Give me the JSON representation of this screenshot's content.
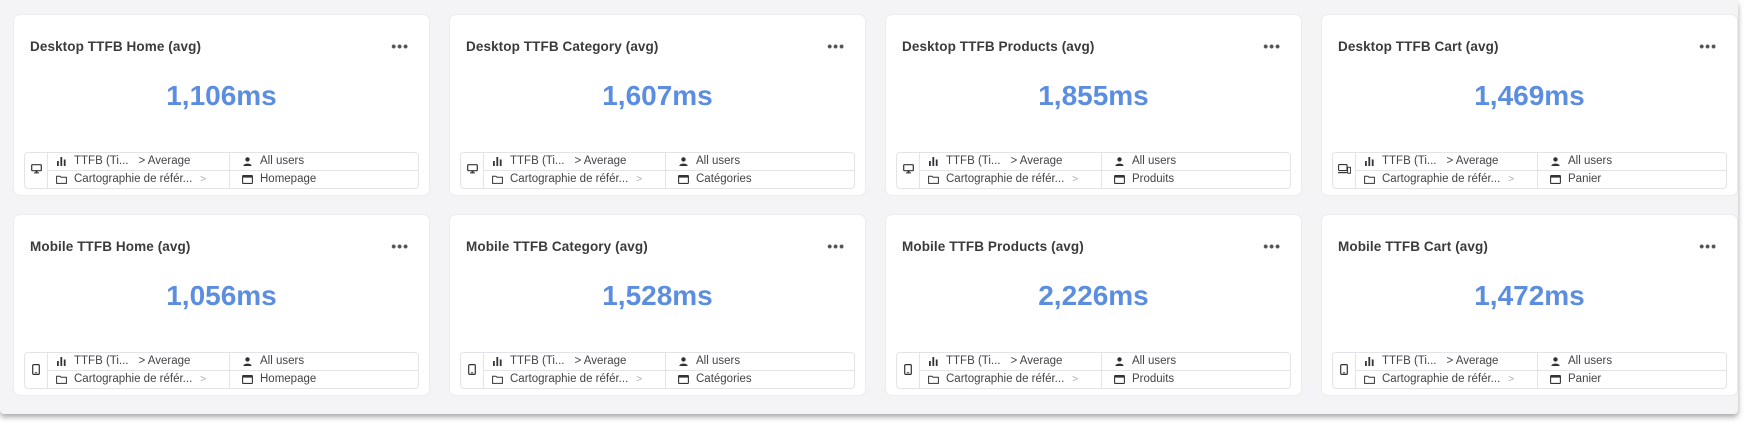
{
  "cards": [
    {
      "title": "Desktop TTFB Home (avg)",
      "value": "1,106ms",
      "device": "desktop-icon",
      "metric": "TTFB (Ti...",
      "agg": "> Average",
      "segment": "All users",
      "project": "Cartographie de référ...",
      "page": "Homepage"
    },
    {
      "title": "Desktop TTFB Category (avg)",
      "value": "1,607ms",
      "device": "desktop-icon",
      "metric": "TTFB (Ti...",
      "agg": "> Average",
      "segment": "All users",
      "project": "Cartographie de référ...",
      "page": "Catégories"
    },
    {
      "title": "Desktop TTFB Products (avg)",
      "value": "1,855ms",
      "device": "desktop-icon",
      "metric": "TTFB (Ti...",
      "agg": "> Average",
      "segment": "All users",
      "project": "Cartographie de référ...",
      "page": "Produits"
    },
    {
      "title": "Desktop TTFB Cart (avg)",
      "value": "1,469ms",
      "device": "desktop-mobile-icon",
      "metric": "TTFB (Ti...",
      "agg": "> Average",
      "segment": "All users",
      "project": "Cartographie de référ...",
      "page": "Panier"
    },
    {
      "title": "Mobile TTFB Home (avg)",
      "value": "1,056ms",
      "device": "mobile-icon",
      "metric": "TTFB (Ti...",
      "agg": "> Average",
      "segment": "All users",
      "project": "Cartographie de référ...",
      "page": "Homepage"
    },
    {
      "title": "Mobile TTFB Category (avg)",
      "value": "1,528ms",
      "device": "mobile-icon",
      "metric": "TTFB (Ti...",
      "agg": "> Average",
      "segment": "All users",
      "project": "Cartographie de référ...",
      "page": "Catégories"
    },
    {
      "title": "Mobile TTFB Products (avg)",
      "value": "2,226ms",
      "device": "mobile-icon",
      "metric": "TTFB (Ti...",
      "agg": "> Average",
      "segment": "All users",
      "project": "Cartographie de référ...",
      "page": "Produits"
    },
    {
      "title": "Mobile TTFB Cart (avg)",
      "value": "1,472ms",
      "device": "mobile-icon",
      "metric": "TTFB (Ti...",
      "agg": "> Average",
      "segment": "All users",
      "project": "Cartographie de référ...",
      "page": "Panier"
    }
  ],
  "more_label": "•••",
  "icons": {
    "metric": "bar-chart-icon",
    "segment": "user-icon",
    "project": "folder-icon",
    "page": "page-icon"
  },
  "colors": {
    "value": "#5b8de0",
    "background": "#f4f4f6",
    "card": "#ffffff"
  }
}
